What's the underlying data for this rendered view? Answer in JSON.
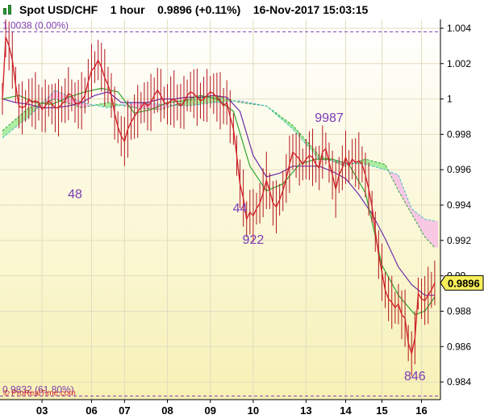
{
  "header": {
    "instrument": "Spot USD/CHF",
    "timeframe": "1 hour",
    "last": "0.9896",
    "change": "(+0.11%)",
    "datetime": "16-Nov-2017 15:03:15"
  },
  "watermark": "© ProRealTime.com",
  "colors": {
    "price": "#d2232a",
    "wick": "#b3171d",
    "fast_line": "#2ea52e",
    "slow_line": "#6a2ea8",
    "cloud_bull": "#a9ec9e",
    "cloud_bear": "#f7c6e3",
    "span_a": "#27a637",
    "span_b": "#3cbfd0",
    "fib": "#7e3cb1",
    "annotation": "#7a3bb5",
    "bg_top": "#ffffff",
    "bg_bottom": "#f7f1b5"
  },
  "chart_data": {
    "type": "line",
    "title": "Spot USD/CHF",
    "y_axis": {
      "range": [
        0.983,
        1.0045
      ],
      "side": "right",
      "ticks": [
        0.984,
        0.986,
        0.988,
        0.99,
        0.992,
        0.994,
        0.996,
        0.998,
        1.0,
        1.002,
        1.004
      ],
      "tick_labels": [
        "0.984",
        "0.986",
        "0.988",
        "0.99",
        "0.992",
        "0.994",
        "0.996",
        "0.998",
        "1",
        "1.002",
        "1.004"
      ]
    },
    "x_axis": {
      "range": [
        0,
        132
      ],
      "ticks": [
        {
          "x": 12,
          "label": "03"
        },
        {
          "x": 27,
          "label": "06"
        },
        {
          "x": 37,
          "label": "07"
        },
        {
          "x": 50,
          "label": "08"
        },
        {
          "x": 63,
          "label": "09"
        },
        {
          "x": 76,
          "label": "10"
        },
        {
          "x": 92,
          "label": "13"
        },
        {
          "x": 104,
          "label": "14"
        },
        {
          "x": 115,
          "label": "15"
        },
        {
          "x": 127,
          "label": "16"
        }
      ]
    },
    "grid": true,
    "current_price": 0.9896,
    "fibonacci_levels": [
      {
        "price": 1.0038,
        "label": "1.0038 (0.00%)"
      },
      {
        "price": 0.9832,
        "label": "0.9832 (61.80%)"
      }
    ],
    "annotations": [
      {
        "x": 22,
        "y": 0.9944,
        "text": "48"
      },
      {
        "x": 72,
        "y": 0.9936,
        "text": "44"
      },
      {
        "x": 76,
        "y": 0.9918,
        "text": "922"
      },
      {
        "x": 99,
        "y": 0.9987,
        "text": "9987"
      },
      {
        "x": 125,
        "y": 0.9841,
        "text": "846"
      }
    ],
    "series": [
      {
        "name": "price",
        "x": [
          0,
          1,
          2,
          3,
          4,
          5,
          6,
          7,
          8,
          9,
          10,
          11,
          12,
          13,
          14,
          15,
          16,
          17,
          18,
          19,
          20,
          21,
          22,
          23,
          24,
          25,
          26,
          27,
          28,
          29,
          30,
          31,
          32,
          33,
          34,
          35,
          36,
          37,
          38,
          39,
          40,
          41,
          42,
          43,
          44,
          45,
          46,
          47,
          48,
          49,
          50,
          51,
          52,
          53,
          54,
          55,
          56,
          57,
          58,
          59,
          60,
          61,
          62,
          63,
          64,
          65,
          66,
          67,
          68,
          69,
          70,
          71,
          72,
          73,
          74,
          75,
          76,
          77,
          78,
          79,
          80,
          81,
          82,
          83,
          84,
          85,
          86,
          87,
          88,
          89,
          90,
          91,
          92,
          93,
          94,
          95,
          96,
          97,
          98,
          99,
          100,
          101,
          102,
          103,
          104,
          105,
          106,
          107,
          108,
          109,
          110,
          111,
          112,
          113,
          114,
          115,
          116,
          117,
          118,
          119,
          120,
          121,
          122,
          123,
          124,
          125,
          126,
          127,
          128,
          129,
          130,
          131
        ],
        "values": [
          1.0,
          1.0035,
          1.003,
          1.0022,
          1.0008,
          0.9996,
          0.9995,
          0.9996,
          1.0,
          0.9998,
          0.9999,
          0.9998,
          0.9994,
          0.9996,
          0.9999,
          0.9997,
          0.9995,
          0.9995,
          0.9997,
          0.9999,
          1.0003,
          1.0002,
          0.9998,
          0.9997,
          0.9999,
          1.0002,
          1.001,
          1.0016,
          1.0018,
          1.0022,
          1.0018,
          1.0012,
          1.0008,
          1.0002,
          0.9992,
          0.9984,
          0.9979,
          0.9976,
          0.9983,
          0.9987,
          0.999,
          0.9993,
          0.9995,
          0.9998,
          0.9996,
          0.9998,
          1.0002,
          1.0005,
          1.0002,
          0.9998,
          0.9997,
          0.9999,
          1.0,
          0.9998,
          0.9996,
          0.9998,
          1.0002,
          1.0004,
          1.0003,
          1.0001,
          0.9999,
          1.0,
          1.0002,
          1.0004,
          1.0003,
          1.0001,
          0.9999,
          0.9996,
          0.9998,
          0.999,
          0.9983,
          0.9968,
          0.9952,
          0.9944,
          0.9932,
          0.9936,
          0.9934,
          0.9938,
          0.9941,
          0.9947,
          0.9954,
          0.9948,
          0.9941,
          0.9939,
          0.9943,
          0.9948,
          0.9955,
          0.9963,
          0.997,
          0.9968,
          0.9966,
          0.9963,
          0.9966,
          0.9968,
          0.9967,
          0.9963,
          0.9961,
          0.997,
          0.9972,
          0.9964,
          0.9957,
          0.9949,
          0.9957,
          0.9961,
          0.9967,
          0.9962,
          0.9966,
          0.9964,
          0.9965,
          0.9963,
          0.9957,
          0.9949,
          0.9939,
          0.9925,
          0.9912,
          0.9902,
          0.9892,
          0.9887,
          0.9885,
          0.9882,
          0.9884,
          0.9878,
          0.9876,
          0.9862,
          0.9856,
          0.9865,
          0.989,
          0.9887,
          0.9886,
          0.9889,
          0.9892,
          0.9896
        ]
      },
      {
        "name": "fast",
        "x": [
          0,
          5,
          10,
          15,
          20,
          25,
          30,
          35,
          40,
          45,
          50,
          55,
          60,
          65,
          70,
          75,
          80,
          85,
          90,
          95,
          100,
          105,
          110,
          115,
          120,
          125,
          128,
          131
        ],
        "values": [
          1.0,
          1.0002,
          0.9998,
          0.9997,
          1.0001,
          1.0004,
          1.0006,
          1.0004,
          0.9992,
          0.9994,
          0.9998,
          0.9999,
          1.0002,
          1.0,
          0.9993,
          0.9962,
          0.9948,
          0.9952,
          0.9963,
          0.9966,
          0.9966,
          0.9963,
          0.9947,
          0.9906,
          0.9889,
          0.9878,
          0.988,
          0.9888
        ]
      },
      {
        "name": "slow",
        "x": [
          0,
          4,
          8,
          12,
          16,
          20,
          24,
          28,
          32,
          36,
          40,
          44,
          48,
          52,
          56,
          60,
          64,
          68,
          72,
          76,
          80,
          84,
          88,
          92,
          96,
          100,
          104,
          108,
          112,
          116,
          120,
          124,
          128,
          131
        ],
        "values": [
          1.0,
          0.9998,
          0.9997,
          0.9995,
          0.9995,
          0.9996,
          0.9998,
          1.0002,
          1.0004,
          0.9998,
          0.9998,
          0.9998,
          1.0,
          1.0,
          1.0001,
          1.0001,
          1.0002,
          1.0001,
          0.9993,
          0.9968,
          0.9956,
          0.9958,
          0.9962,
          0.9962,
          0.9962,
          0.9959,
          0.9955,
          0.9946,
          0.9935,
          0.9921,
          0.9905,
          0.9895,
          0.9889,
          0.9889
        ]
      },
      {
        "name": "span_a",
        "x": [
          0,
          8,
          16,
          24,
          32,
          40,
          48,
          56,
          64,
          72,
          80,
          88,
          96,
          104,
          110,
          116,
          120,
          124,
          128,
          131
        ],
        "values": [
          0.9982,
          0.9995,
          1.0,
          0.9995,
          0.9998,
          0.9995,
          0.9994,
          0.9999,
          1.0002,
          0.9998,
          0.9996,
          0.9985,
          0.9968,
          0.9962,
          0.9966,
          0.9963,
          0.9948,
          0.9935,
          0.9922,
          0.9916
        ]
      },
      {
        "name": "span_b",
        "x": [
          0,
          8,
          16,
          24,
          32,
          40,
          48,
          56,
          64,
          72,
          80,
          88,
          96,
          104,
          110,
          116,
          120,
          124,
          128,
          131
        ],
        "values": [
          0.9978,
          0.999,
          1.0005,
          0.9998,
          0.9995,
          0.9998,
          0.9997,
          0.9996,
          0.9998,
          0.9999,
          0.9996,
          0.9983,
          0.9966,
          0.9964,
          0.9963,
          0.996,
          0.9957,
          0.9938,
          0.9932,
          0.9931
        ]
      }
    ]
  }
}
